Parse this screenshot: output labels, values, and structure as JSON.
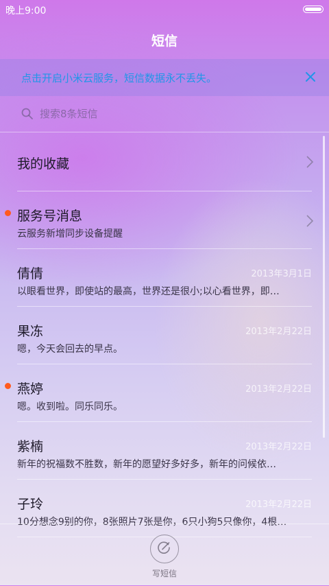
{
  "status": {
    "time": "晚上9:00"
  },
  "header": {
    "title": "短信"
  },
  "banner": {
    "text": "点击开启小米云服务，短信数据永不丢失。"
  },
  "search": {
    "placeholder": "搜索8条短信"
  },
  "favorites": {
    "label": "我的收藏"
  },
  "service": {
    "name": "服务号消息",
    "preview": "云服务新增同步设备提醒",
    "unread": true
  },
  "conversations": [
    {
      "name": "倩倩",
      "date": "2013年3月1日",
      "preview": "以眼看世界，即使站的最高，世界还是很小;以心看世界，即…",
      "unread": false
    },
    {
      "name": "果冻",
      "date": "2013年2月22日",
      "preview": "嗯，今天会回去的早点。",
      "unread": false
    },
    {
      "name": "燕婷",
      "date": "2013年2月22日",
      "preview": "嗯。收到啦。同乐同乐。",
      "unread": true
    },
    {
      "name": "紫楠",
      "date": "2013年2月22日",
      "preview": "新年的祝福数不胜数，新年的愿望好多好多，新年的问候依…",
      "unread": false
    },
    {
      "name": "子玲",
      "date": "2013年2月22日",
      "preview": "10分想念9别的你，8张照片7张是你，6只小狗5只像你，4根…",
      "unread": false
    }
  ],
  "compose": {
    "label": "写短信"
  },
  "colors": {
    "accent": "#2196e8",
    "unread_dot": "#ff5a1f"
  },
  "icons": {
    "banner_close": "close-icon",
    "search": "search-icon",
    "chevron": "chevron-right-icon",
    "compose": "compose-icon"
  }
}
